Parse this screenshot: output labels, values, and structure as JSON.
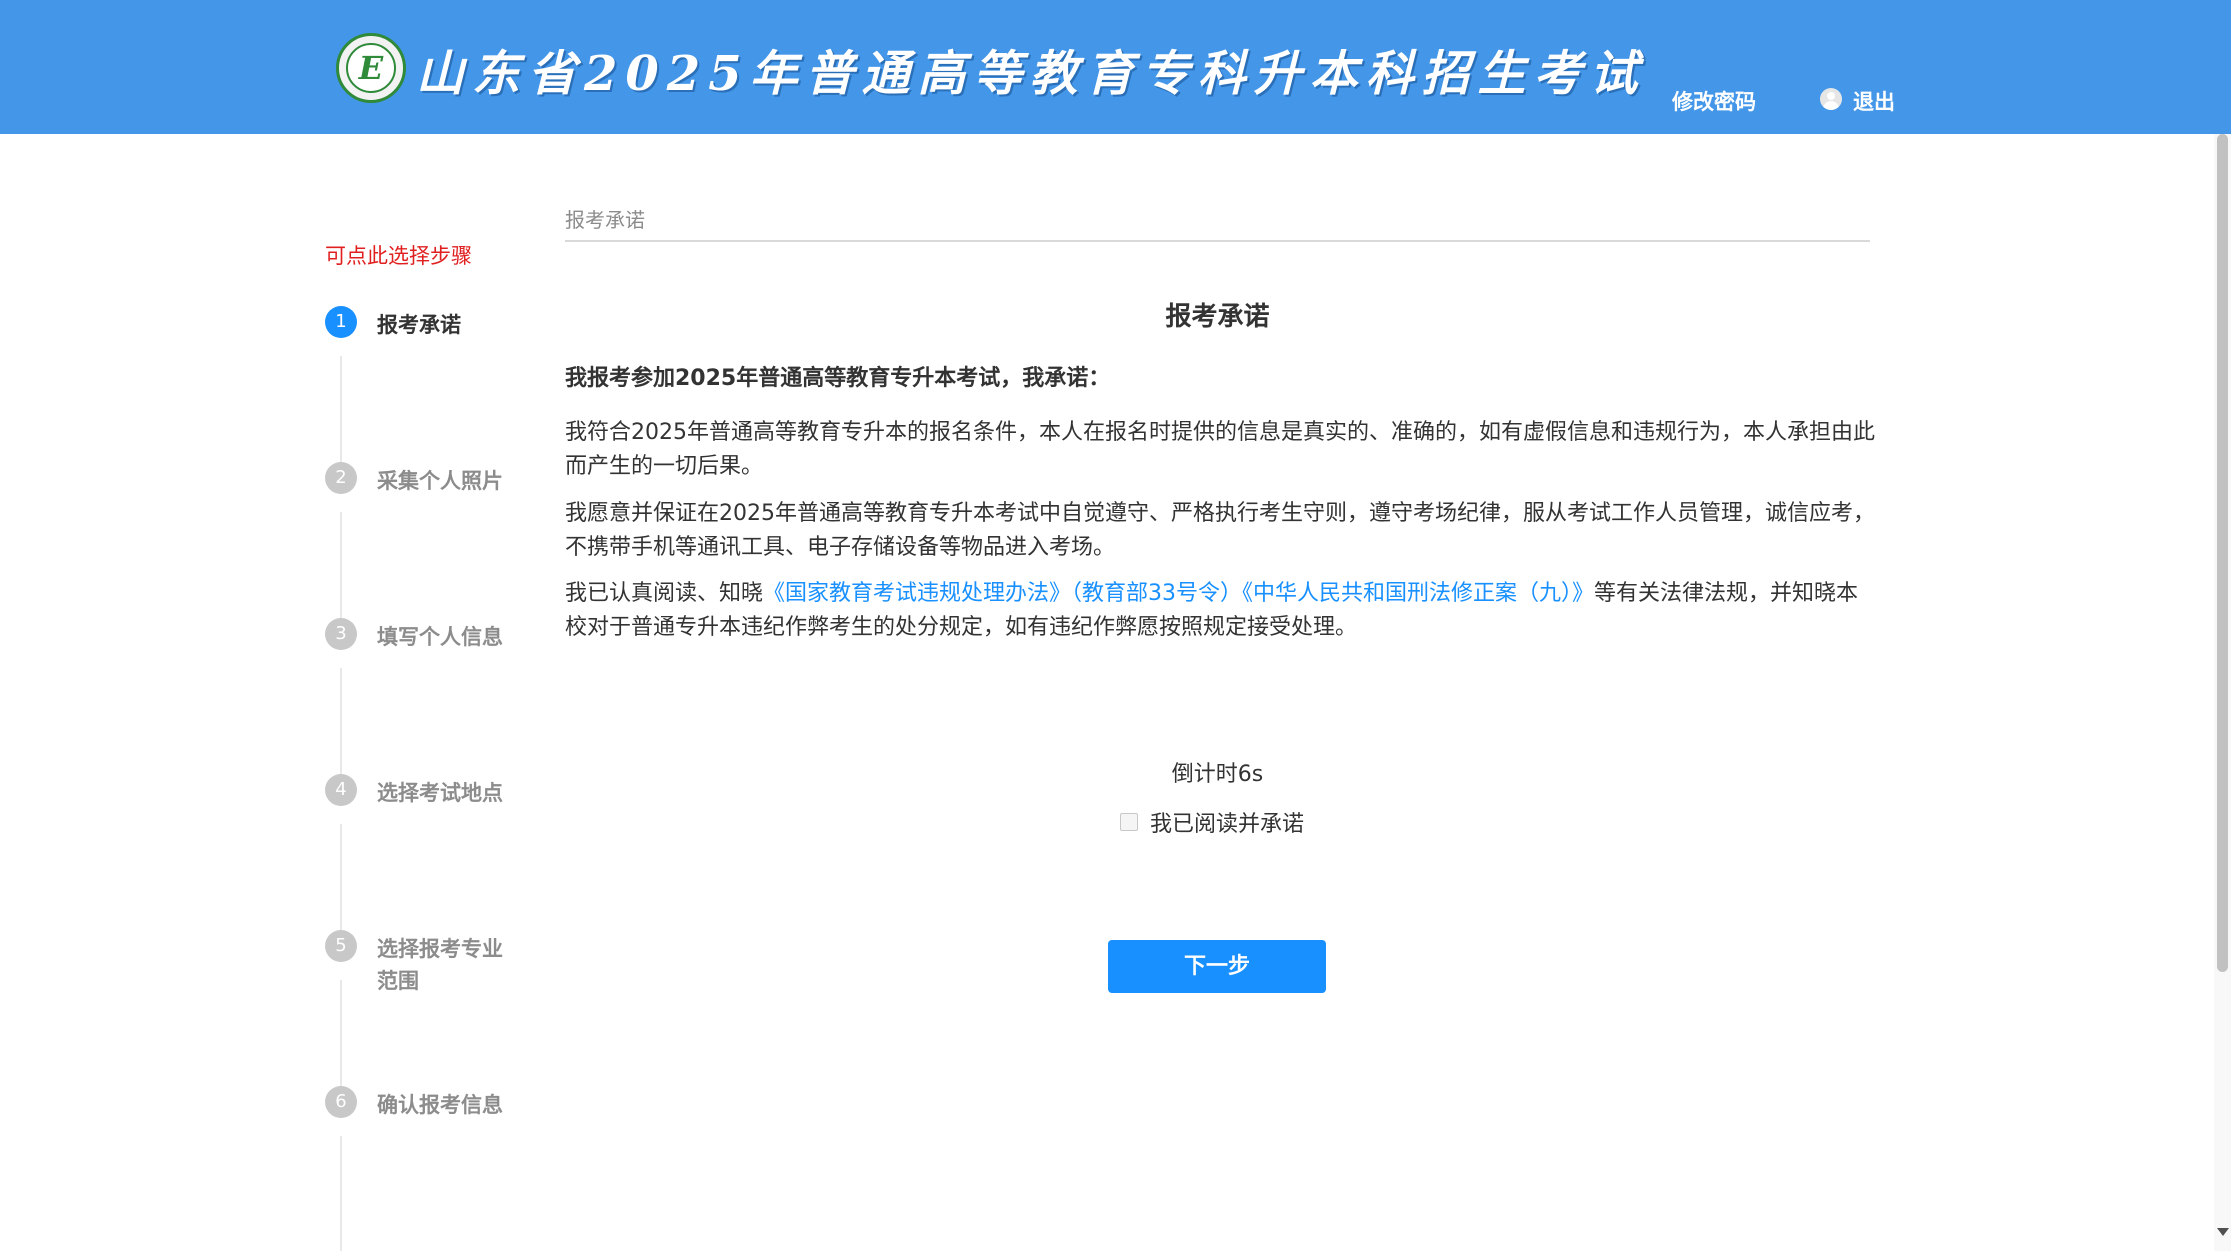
{
  "header": {
    "title": "山东省2025年普通高等教育专科升本科招生考试",
    "change_password": "修改密码",
    "logout": "退出",
    "logo_letter": "E"
  },
  "sidebar": {
    "hint": "可点此选择步骤",
    "steps": [
      {
        "num": "1",
        "label": "报考承诺",
        "active": true
      },
      {
        "num": "2",
        "label": "采集个人照片",
        "active": false
      },
      {
        "num": "3",
        "label": "填写个人信息",
        "active": false
      },
      {
        "num": "4",
        "label": "选择考试地点",
        "active": false
      },
      {
        "num": "5",
        "label": "选择报考专业范围",
        "active": false
      },
      {
        "num": "6",
        "label": "确认报考信息",
        "active": false
      }
    ]
  },
  "main": {
    "breadcrumb": "报考承诺",
    "title": "报考承诺",
    "lead": "我报考参加2025年普通高等教育专升本考试，我承诺：",
    "para1": "我符合2025年普通高等教育专升本的报名条件，本人在报名时提供的信息是真实的、准确的，如有虚假信息和违规行为，本人承担由此而产生的一切后果。",
    "para2": "我愿意并保证在2025年普通高等教育专升本考试中自觉遵守、严格执行考生守则，遵守考场纪律，服从考试工作人员管理，诚信应考，不携带手机等通讯工具、电子存储设备等物品进入考场。",
    "para3_prefix": "我已认真阅读、知晓",
    "para3_link1": "《国家教育考试违规处理办法》（教育部33号令）",
    "para3_link2": "《中华人民共和国刑法修正案（九）》",
    "para3_suffix": "等有关法律法规，并知晓本校对于普通专升本违纪作弊考生的处分规定，如有违纪作弊愿按照规定接受处理。",
    "countdown": "倒计时6s",
    "agree_label": "我已阅读并承诺",
    "next_button": "下一步"
  },
  "colors": {
    "header_bg": "#4396e8",
    "primary": "#1890ff",
    "hint_red": "#e02020"
  }
}
